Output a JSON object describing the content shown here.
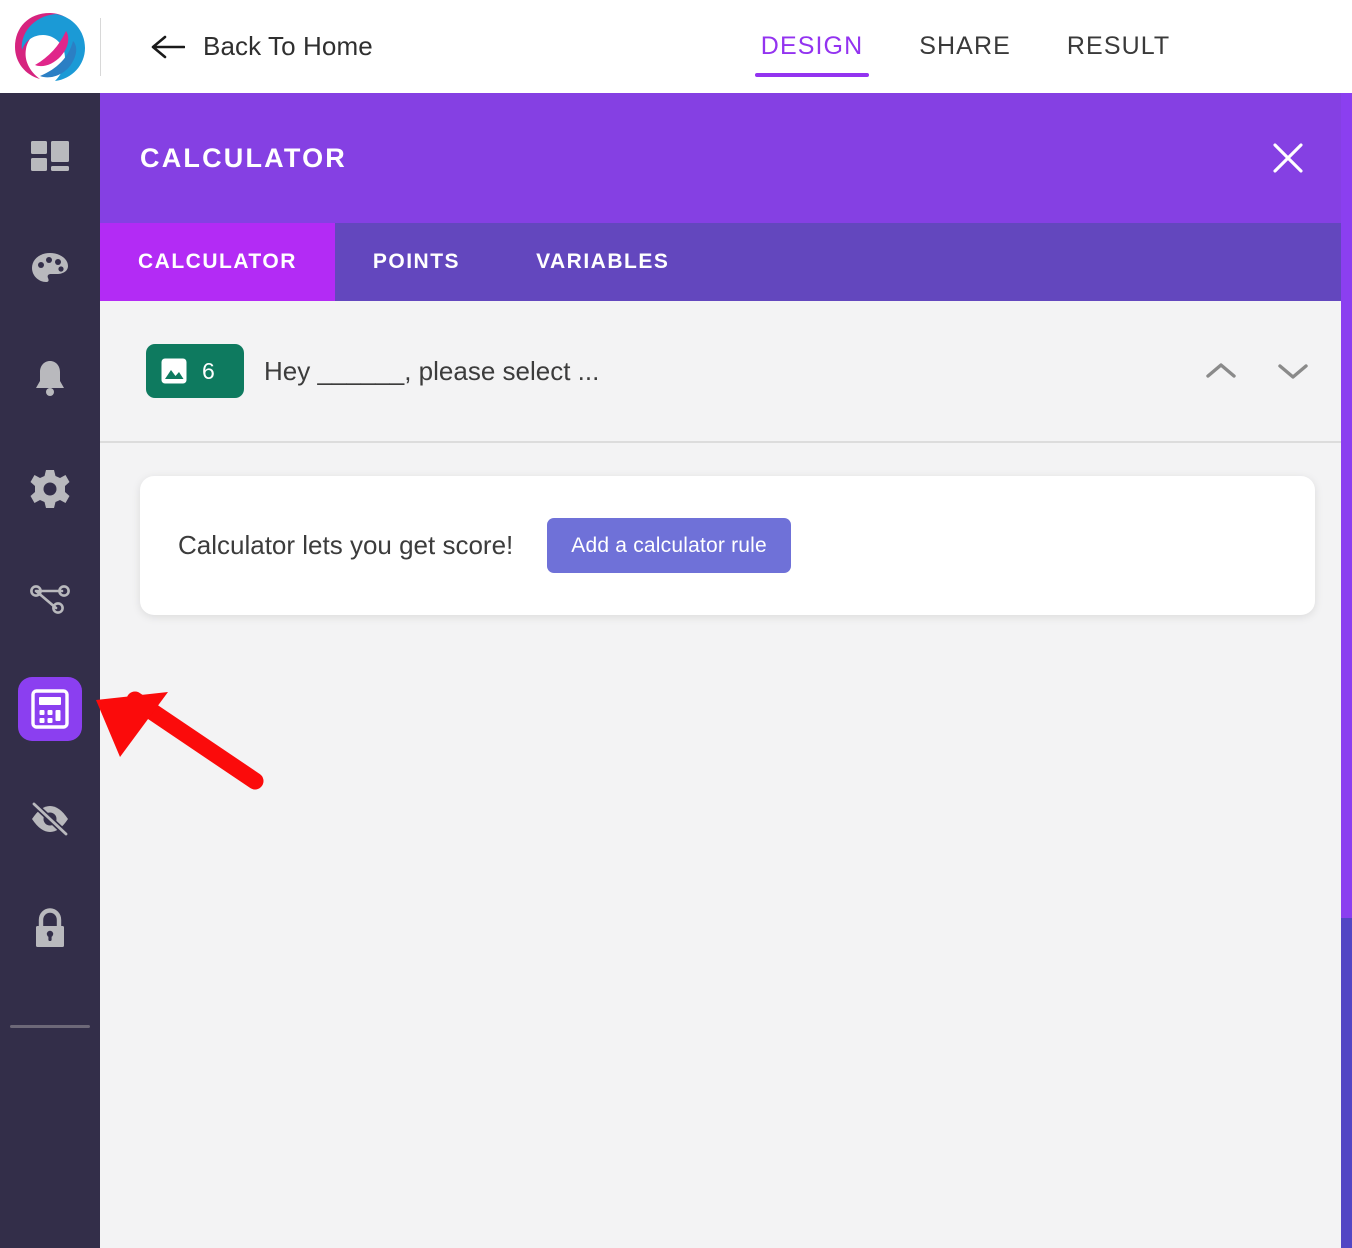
{
  "topbar": {
    "logo_icon": "quillforms-logo",
    "back": {
      "icon": "arrow-left-icon",
      "label": "Back To Home"
    },
    "tabs": [
      {
        "label": "DESIGN",
        "active": true
      },
      {
        "label": "SHARE",
        "active": false
      },
      {
        "label": "RESULT",
        "active": false
      }
    ],
    "accent_color": "#9333f0"
  },
  "sidebar": {
    "background": "#332e49",
    "active_color": "#8b3ff0",
    "items": [
      {
        "name": "dashboard",
        "icon": "grid-icon",
        "active": false
      },
      {
        "name": "theme",
        "icon": "palette-icon",
        "active": false
      },
      {
        "name": "notifications",
        "icon": "bell-icon",
        "active": false
      },
      {
        "name": "settings",
        "icon": "gear-icon",
        "active": false
      },
      {
        "name": "logic",
        "icon": "logic-flow-icon",
        "active": false
      },
      {
        "name": "calculator",
        "icon": "calculator-icon",
        "active": true
      },
      {
        "name": "hidden-fields",
        "icon": "eye-off-icon",
        "active": false
      },
      {
        "name": "lock",
        "icon": "lock-icon",
        "active": false
      }
    ]
  },
  "panel": {
    "title": "CALCULATOR",
    "header_color": "#8540e3",
    "tabbar_color": "#6347be",
    "active_tab_color": "#b32bf5",
    "close_icon": "close-icon",
    "tabs": [
      {
        "label": "CALCULATOR",
        "active": true
      },
      {
        "label": "POINTS",
        "active": false
      },
      {
        "label": "VARIABLES",
        "active": false
      }
    ]
  },
  "question": {
    "badge": {
      "icon": "image-icon",
      "number": "6",
      "color": "#0e7a5f"
    },
    "text": "Hey ______, please select ...",
    "controls": [
      {
        "name": "move-up",
        "icon": "chevron-up-icon"
      },
      {
        "name": "move-down",
        "icon": "chevron-down-icon"
      }
    ]
  },
  "card": {
    "message": "Calculator lets you get score!",
    "button_label": "Add a calculator rule",
    "button_color": "#6f71d8"
  },
  "annotation": {
    "type": "arrow",
    "color": "#fb0b0b",
    "points_to": "sidebar-item-calculator"
  }
}
